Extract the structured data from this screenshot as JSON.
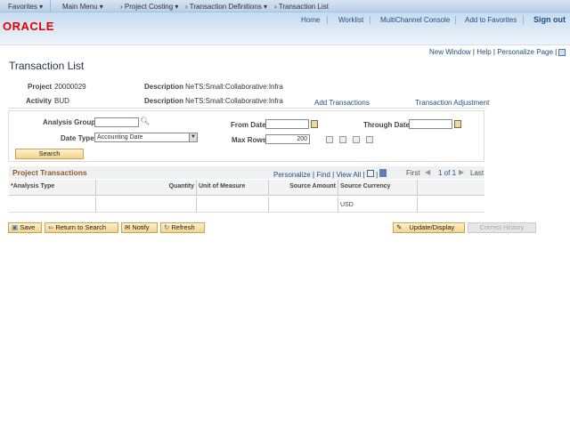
{
  "topnav": {
    "favorites": "Favorites",
    "main_menu": "Main Menu",
    "breadcrumbs": [
      "Project Costing",
      "Transaction Definitions",
      "Transaction List"
    ]
  },
  "banner": {
    "logo": "ORACLE",
    "links": [
      "Home",
      "Worklist",
      "MultiChannel Console",
      "Add to Favorites"
    ],
    "sign_out": "Sign out"
  },
  "pagebar": {
    "new_window": "New Window",
    "help": "Help",
    "personalize_page": "Personalize Page"
  },
  "page_title": "Transaction List",
  "header": {
    "project_label": "Project",
    "project_value": "20000029",
    "activity_label": "Activity",
    "activity_value": "BUD",
    "description_label": "Description",
    "project_description": "NeTS:Small:Collaborative:Infra",
    "activity_description": "NeTS:Small:Collaborative:Infra",
    "add_transactions": "Add Transactions",
    "transaction_adjustment": "Transaction Adjustment"
  },
  "search": {
    "analysis_group_label": "Analysis Group",
    "analysis_group_value": "",
    "date_type_label": "Date Type",
    "date_type_value": "Accounting Date",
    "from_date_label": "From Date",
    "from_date_value": "",
    "through_date_label": "Through Date",
    "through_date_value": "",
    "max_rows_label": "Max Rows",
    "max_rows_value": "200",
    "search_button": "Search"
  },
  "grid": {
    "title": "Project Transactions",
    "personalize": "Personalize",
    "find": "Find",
    "view_all": "View All",
    "first": "First",
    "page_info": "1 of 1",
    "last": "Last",
    "columns": [
      "*Analysis Type",
      "Quantity",
      "Unit of Measure",
      "Source Amount",
      "Source Currency"
    ],
    "rows": [
      {
        "analysis_type": "",
        "quantity": "",
        "unit_of_measure": "",
        "source_amount": "",
        "source_currency": "USD"
      }
    ]
  },
  "toolbar": {
    "save": "Save",
    "return_to_search": "Return to Search",
    "notify": "Notify",
    "refresh": "Refresh",
    "update_display": "Update/Display",
    "correct_history": "Correct History"
  }
}
